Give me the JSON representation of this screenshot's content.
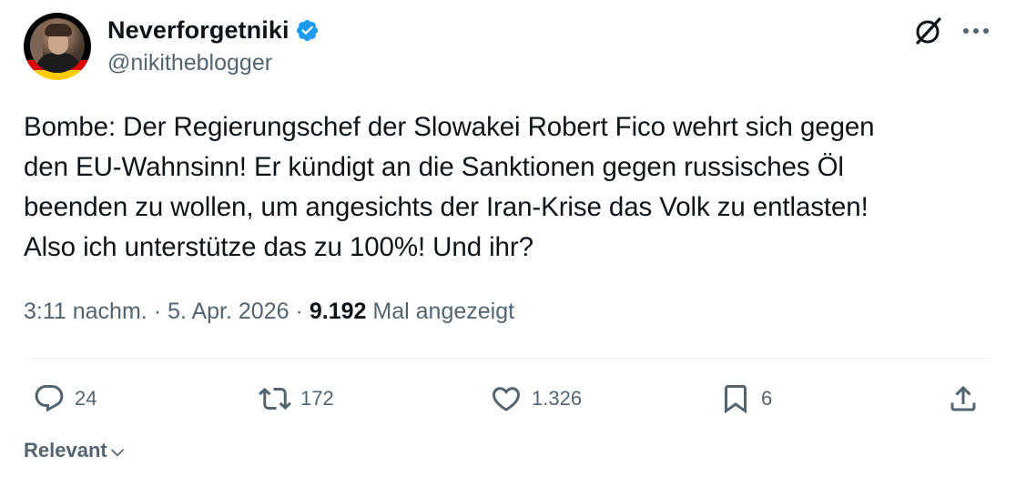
{
  "author": {
    "display_name": "Neverforgetniki",
    "handle": "@nikitheblogger",
    "verified": true,
    "verified_color": "#1d9bf0"
  },
  "tweet": {
    "text": "Bombe: Der Regierungschef der Slowakei Robert Fico wehrt sich gegen\nden EU-Wahnsinn! Er kündigt an die Sanktionen gegen russisches Öl\nbeenden zu wollen, um angesichts der Iran-Krise das Volk zu entlasten!\nAlso ich unterstütze das zu 100%! Und ihr?",
    "time": "3:11 nachm.",
    "separator": "·",
    "date": "5. Apr. 2026",
    "views_count": "9.192",
    "views_label": "Mal angezeigt"
  },
  "actions": {
    "replies": "24",
    "reposts": "172",
    "likes": "1.326",
    "bookmarks": "6"
  },
  "icons": {
    "top_right": [
      "grok-icon",
      "more-icon"
    ],
    "actions": [
      "reply-icon",
      "repost-icon",
      "like-icon",
      "bookmark-icon",
      "share-icon"
    ]
  },
  "sort": {
    "label": "Relevant"
  },
  "colors": {
    "text_primary": "#0f1419",
    "text_secondary": "#536471",
    "divider": "#eff3f4"
  }
}
